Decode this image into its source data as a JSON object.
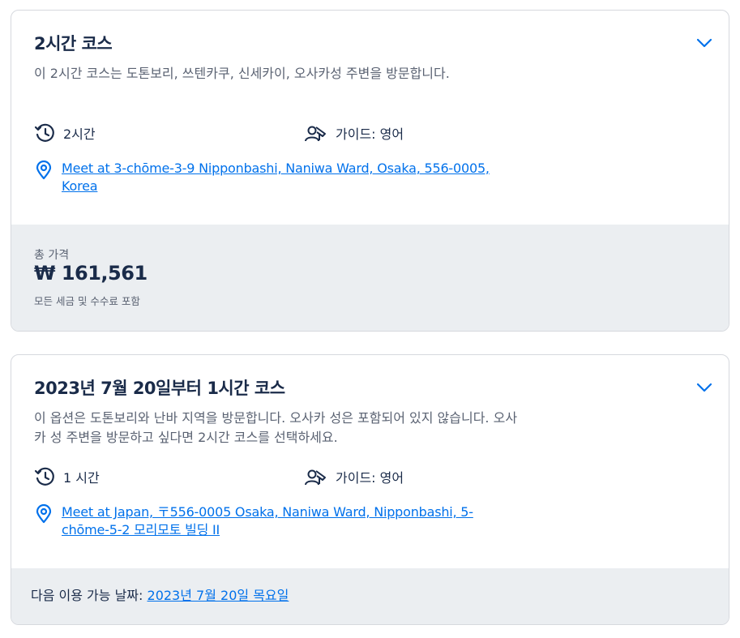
{
  "options": [
    {
      "title": "2시간 코스",
      "description": "이 2시간 코스는 도톤보리, 쓰텐카쿠, 신세카이, 오사카성 주변을 방문합니다.",
      "duration": "2시간",
      "guide": "가이드: 영어",
      "location": "Meet at 3-chōme-3-9 Nipponbashi, Naniwa Ward, Osaka, 556-0005, Korea",
      "price_label": "총 가격",
      "price": "₩ 161,561",
      "price_note": "모든 세금 및 수수료 포함"
    },
    {
      "title": "2023년 7월 20일부터 1시간 코스",
      "description": "이 옵션은 도톤보리와 난바 지역을 방문합니다. 오사카 성은 포함되어 있지 않습니다. 오사카 성 주변을 방문하고 싶다면 2시간 코스를 선택하세요.",
      "duration": "1 시간",
      "guide": "가이드: 영어",
      "location": "Meet at Japan, 〒556-0005 Osaka, Naniwa Ward, Nipponbashi, 5-chōme-5-2 모리모토 빌딩 II",
      "availability_label": "다음 이용 가능 날짜:",
      "availability_date": "2023년 7월 20일 목요일"
    }
  ],
  "colors": {
    "text_primary": "#1a2b49",
    "text_secondary": "#5a6272",
    "link": "#0071eb",
    "footer_bg": "#ebeef1",
    "border": "#d6d9de"
  },
  "icons": [
    "chevron-down-icon",
    "clock-icon",
    "guide-icon",
    "location-pin-icon"
  ]
}
